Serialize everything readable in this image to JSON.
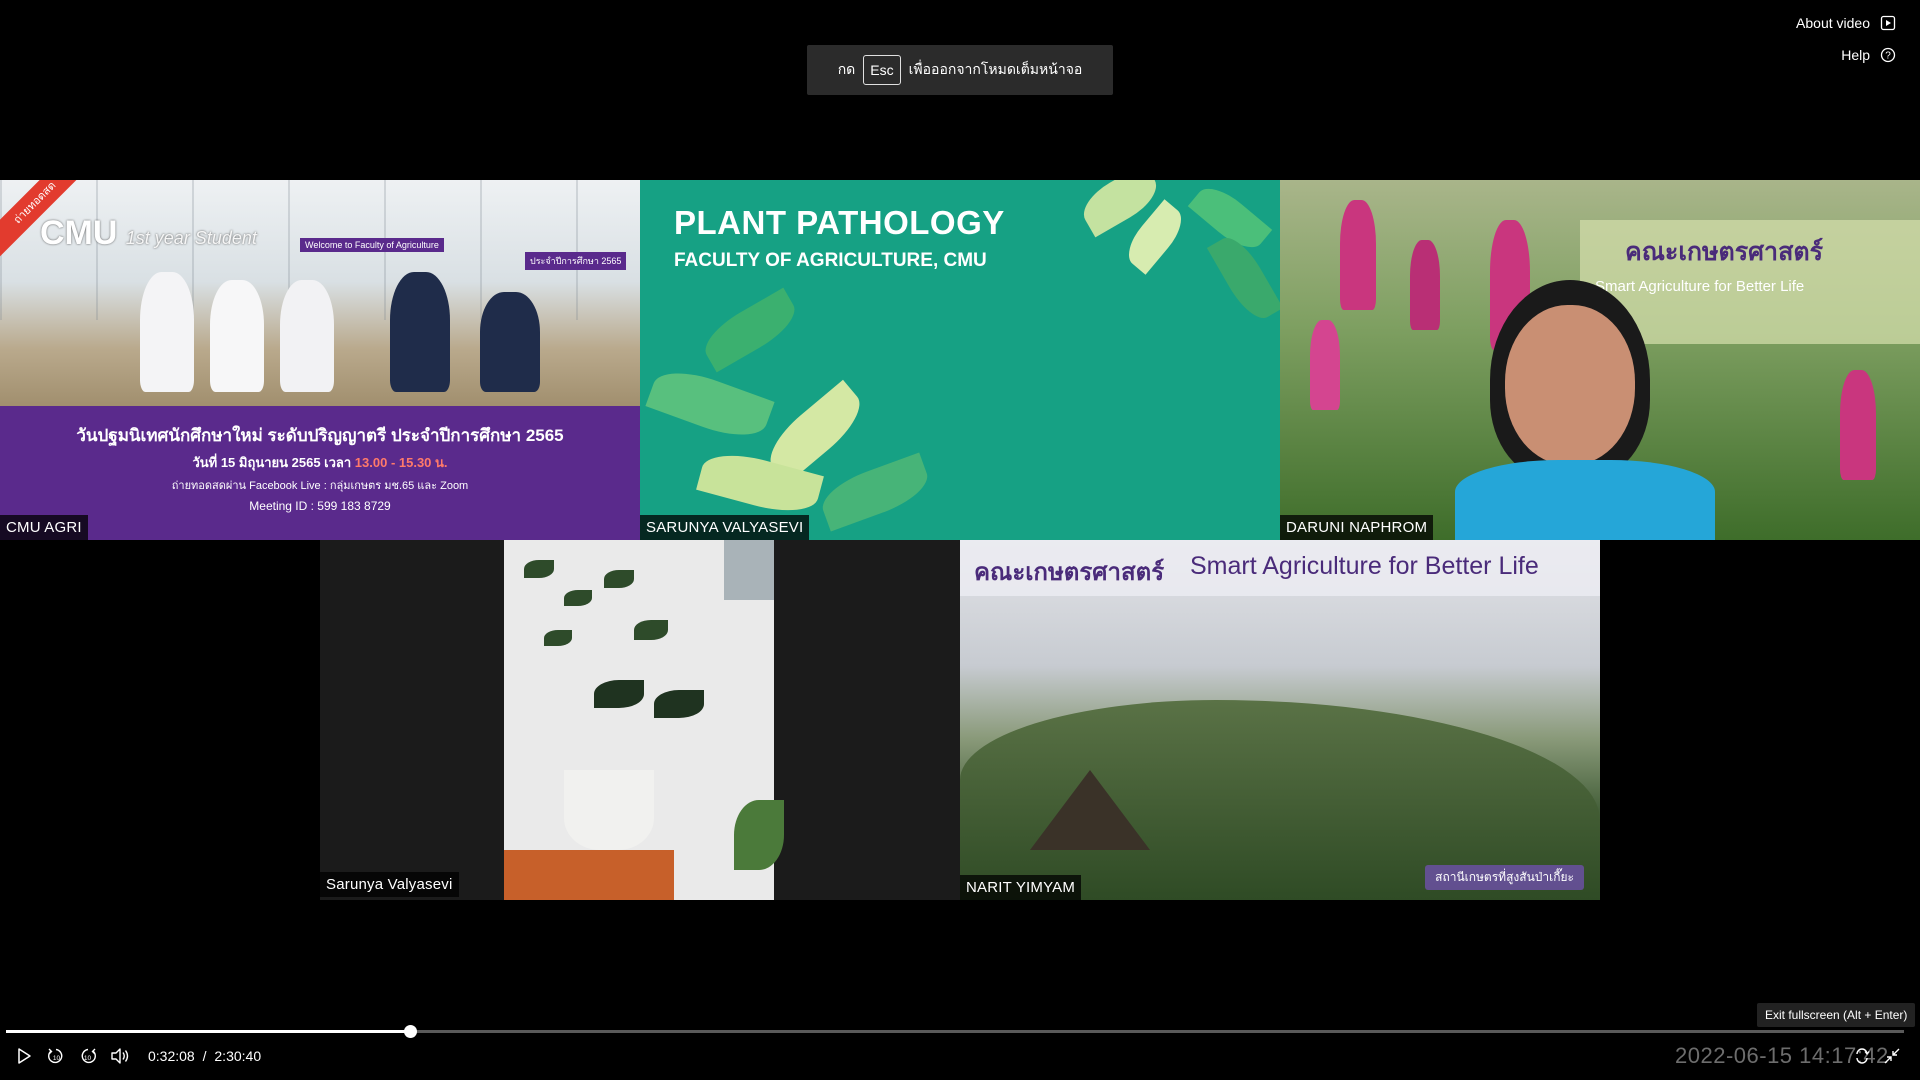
{
  "top_links": {
    "about_video": "About video",
    "help": "Help"
  },
  "esc_toast": {
    "prefix": "กด",
    "key": "Esc",
    "suffix": "เพื่อออกจากโหมดเต็มหน้าจอ"
  },
  "tiles": [
    {
      "name": "CMU AGRI",
      "content": {
        "logo": "CMU",
        "script": "1st year Student",
        "welcome": "Welcome to Faculty of Agriculture",
        "year_tag": "ประจำปีการศึกษา 2565",
        "headline": "วันปฐมนิเทศนักศึกษาใหม่ ระดับปริญญาตรี ประจำปีการศึกษา 2565",
        "date_line_prefix": "วันที่ 15 มิถุนายน 2565 เวลา ",
        "date_line_time": "13.00 - 15.30 น.",
        "live_line": "ถ่ายทอดสดผ่าน Facebook Live : กลุ่มเกษตร มช.65 และ Zoom",
        "meeting_line": "Meeting ID : 599 183 8729",
        "ribbon": "ถ่ายทอดสด"
      }
    },
    {
      "name": "SARUNYA VALYASEVI",
      "content": {
        "title": "PLANT PATHOLOGY",
        "subtitle": "FACULTY OF AGRICULTURE, CMU"
      }
    },
    {
      "name": "DARUNI NAPHROM",
      "content": {
        "banner_logo": "คณะเกษตรศาสตร์",
        "banner_tagline": "Smart Agriculture for Better Life"
      }
    },
    {
      "name": "Sarunya Valyasevi"
    },
    {
      "name": "NARIT YIMYAM",
      "content": {
        "banner_logo": "คณะเกษตรศาสตร์",
        "banner_tagline": "Smart Agriculture for Better Life",
        "bottom_tag": "สถานีเกษตรที่สูงสันป่าเกี๊ยะ"
      }
    }
  ],
  "player": {
    "current_time": "0:32:08",
    "separator": "/",
    "duration": "2:30:40",
    "progress_fraction": 0.2131,
    "exit_fullscreen_tooltip": "Exit fullscreen (Alt + Enter)",
    "timestamp_overlay": "2022-06-15  14:17:42"
  }
}
